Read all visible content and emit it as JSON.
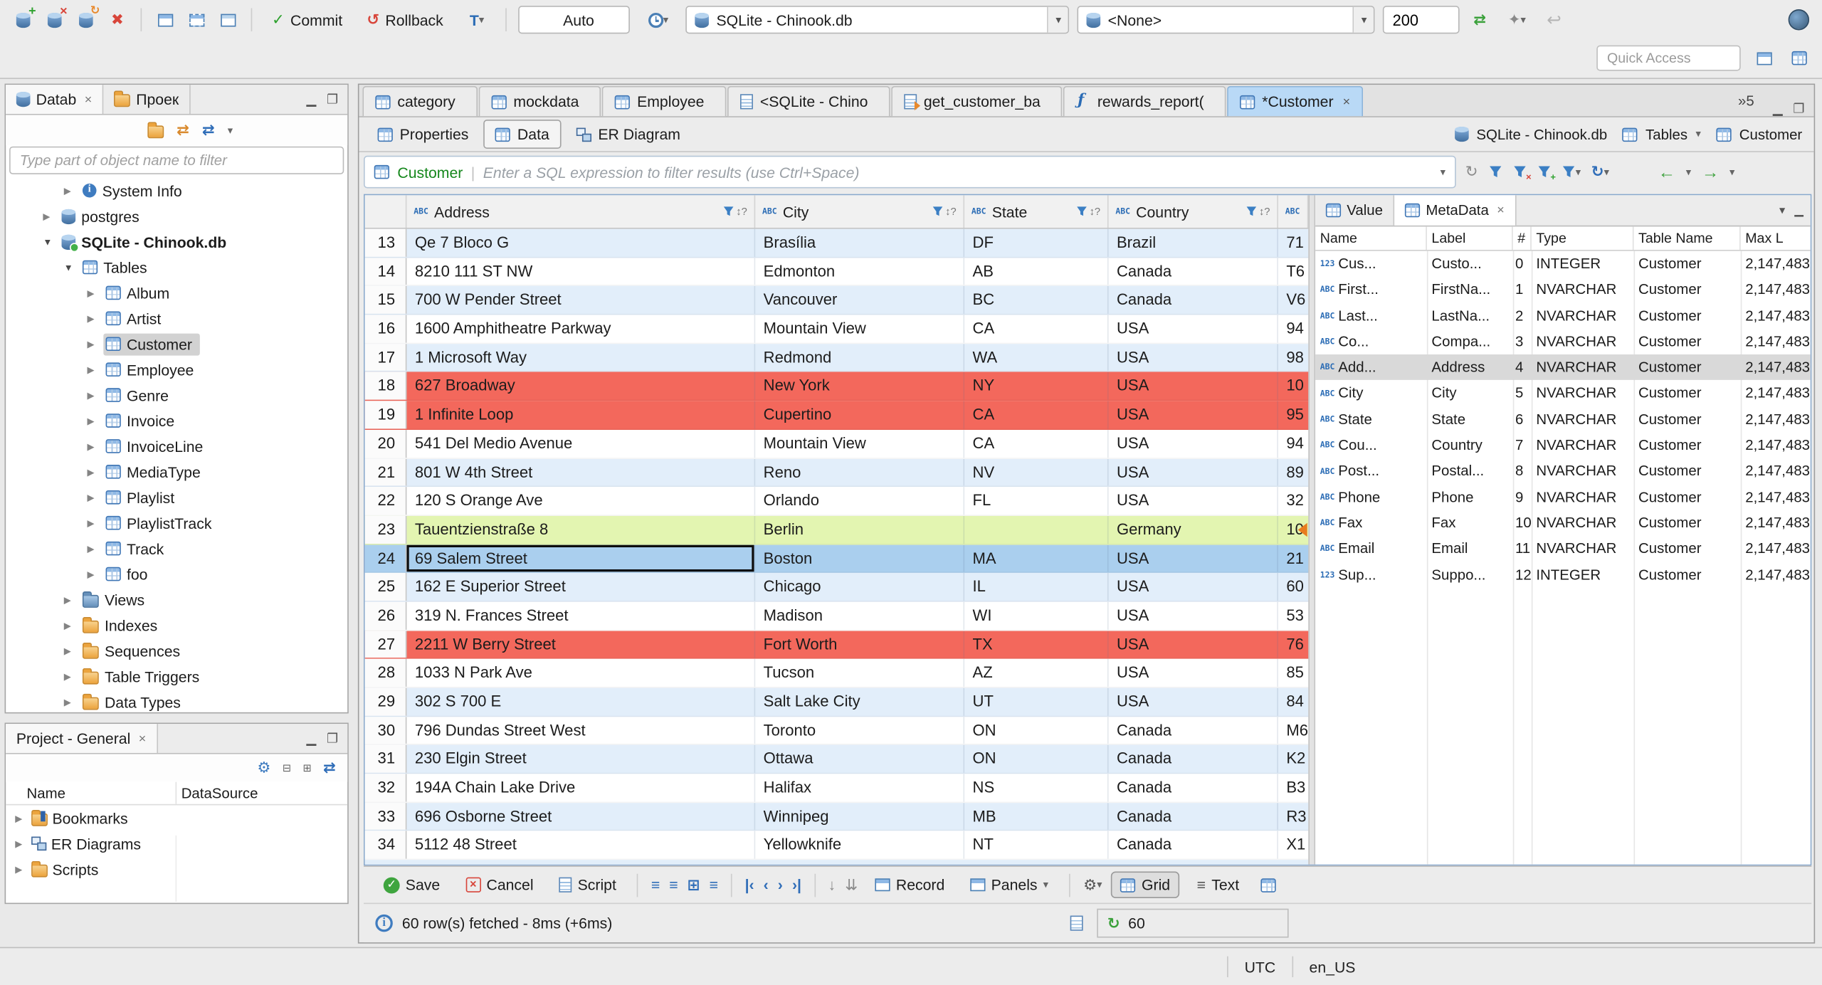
{
  "window": {
    "timezone": "UTC",
    "locale": "en_US"
  },
  "toolbar": {
    "commit_label": "Commit",
    "rollback_label": "Rollback",
    "txn_mode": "Auto",
    "connection": "SQLite - Chinook.db",
    "schema": "<None>",
    "fetch_limit": "200",
    "quick_access_placeholder": "Quick Access"
  },
  "navigator": {
    "tabs": [
      {
        "label": "Datab",
        "icon": "db",
        "state": "active",
        "close": "×"
      },
      {
        "label": "Проек",
        "icon": "folder",
        "state": ""
      }
    ],
    "filter_placeholder": "Type part of object name to filter",
    "tree": [
      {
        "label": "System Info",
        "depth": "1",
        "arrow": "right",
        "icon": "info",
        "state": ""
      },
      {
        "label": "postgres",
        "depth": "0",
        "arrow": "right",
        "icon": "db",
        "state": ""
      },
      {
        "label": "SQLite - Chinook.db",
        "depth": "0",
        "arrow": "down",
        "icon": "db-green",
        "state": "connected"
      },
      {
        "label": "Tables",
        "depth": "1",
        "arrow": "down",
        "icon": "folder-table",
        "state": ""
      },
      {
        "label": "Album",
        "depth": "2",
        "arrow": "right",
        "icon": "table",
        "state": ""
      },
      {
        "label": "Artist",
        "depth": "2",
        "arrow": "right",
        "icon": "table",
        "state": ""
      },
      {
        "label": "Customer",
        "depth": "2",
        "arrow": "right",
        "icon": "table",
        "state": "selected"
      },
      {
        "label": "Employee",
        "depth": "2",
        "arrow": "right",
        "icon": "table",
        "state": ""
      },
      {
        "label": "Genre",
        "depth": "2",
        "arrow": "right",
        "icon": "table",
        "state": ""
      },
      {
        "label": "Invoice",
        "depth": "2",
        "arrow": "right",
        "icon": "table",
        "state": ""
      },
      {
        "label": "InvoiceLine",
        "depth": "2",
        "arrow": "right",
        "icon": "table",
        "state": ""
      },
      {
        "label": "MediaType",
        "depth": "2",
        "arrow": "right",
        "icon": "table",
        "state": ""
      },
      {
        "label": "Playlist",
        "depth": "2",
        "arrow": "right",
        "icon": "table",
        "state": ""
      },
      {
        "label": "PlaylistTrack",
        "depth": "2",
        "arrow": "right",
        "icon": "table",
        "state": ""
      },
      {
        "label": "Track",
        "depth": "2",
        "arrow": "right",
        "icon": "table",
        "state": ""
      },
      {
        "label": "foo",
        "depth": "2",
        "arrow": "right",
        "icon": "table",
        "state": ""
      },
      {
        "label": "Views",
        "depth": "1",
        "arrow": "right",
        "icon": "folder-blue",
        "state": ""
      },
      {
        "label": "Indexes",
        "depth": "1",
        "arrow": "right",
        "icon": "folder",
        "state": ""
      },
      {
        "label": "Sequences",
        "depth": "1",
        "arrow": "right",
        "icon": "folder",
        "state": ""
      },
      {
        "label": "Table Triggers",
        "depth": "1",
        "arrow": "right",
        "icon": "folder",
        "state": ""
      },
      {
        "label": "Data Types",
        "depth": "1",
        "arrow": "right",
        "icon": "folder",
        "state": ""
      }
    ]
  },
  "project": {
    "tab": "Project - General",
    "close": "×",
    "columns": [
      "Name",
      "DataSource"
    ],
    "items": [
      {
        "label": "Bookmarks",
        "icon": "folder-bookmark",
        "arrow": "right"
      },
      {
        "label": "ER Diagrams",
        "icon": "diagram",
        "arrow": "right"
      },
      {
        "label": "Scripts",
        "icon": "folder",
        "arrow": "right"
      }
    ]
  },
  "editor": {
    "tabs": [
      {
        "label": "category",
        "icon": "table",
        "state": ""
      },
      {
        "label": "mockdata",
        "icon": "table",
        "state": ""
      },
      {
        "label": "Employee",
        "icon": "table",
        "state": ""
      },
      {
        "label": "<SQLite - Chino",
        "icon": "sql",
        "state": ""
      },
      {
        "label": "get_customer_ba",
        "icon": "view",
        "state": ""
      },
      {
        "label": "rewards_report(",
        "icon": "func",
        "state": ""
      },
      {
        "label": "*Customer",
        "icon": "table",
        "state": "active",
        "close": "×"
      }
    ],
    "more_tabs": "»5",
    "subtabs": [
      {
        "label": "Properties",
        "icon": "props",
        "state": ""
      },
      {
        "label": "Data",
        "icon": "grid",
        "state": "active"
      },
      {
        "label": "ER Diagram",
        "icon": "diagram",
        "state": ""
      }
    ],
    "breadcrumb": {
      "connection": "SQLite - Chinook.db",
      "container": "Tables",
      "entity": "Customer"
    },
    "filter_entity": "Customer",
    "filter_placeholder": "Enter a SQL expression to filter results (use Ctrl+Space)"
  },
  "grid": {
    "columns": [
      {
        "key": "address",
        "label": "Address",
        "chip": "ABC"
      },
      {
        "key": "city",
        "label": "City",
        "chip": "ABC"
      },
      {
        "key": "state",
        "label": "State",
        "chip": "ABC"
      },
      {
        "key": "country",
        "label": "Country",
        "chip": "ABC"
      },
      {
        "key": "extra",
        "label": "",
        "chip": "ABC"
      }
    ],
    "rows": [
      {
        "num": "13",
        "hl": "",
        "cells": [
          "Qe 7 Bloco G",
          "Brasília",
          "DF",
          "Brazil",
          "71"
        ]
      },
      {
        "num": "14",
        "hl": "",
        "cells": [
          "8210 111 ST NW",
          "Edmonton",
          "AB",
          "Canada",
          "T6"
        ]
      },
      {
        "num": "15",
        "hl": "",
        "cells": [
          "700 W Pender Street",
          "Vancouver",
          "BC",
          "Canada",
          "V6"
        ]
      },
      {
        "num": "16",
        "hl": "",
        "cells": [
          "1600 Amphitheatre Parkway",
          "Mountain View",
          "CA",
          "USA",
          "94"
        ]
      },
      {
        "num": "17",
        "hl": "",
        "cells": [
          "1 Microsoft Way",
          "Redmond",
          "WA",
          "USA",
          "98"
        ]
      },
      {
        "num": "18",
        "hl": "red",
        "cells": [
          "627 Broadway",
          "New York",
          "NY",
          "USA",
          "10"
        ]
      },
      {
        "num": "19",
        "hl": "red",
        "cells": [
          "1 Infinite Loop",
          "Cupertino",
          "CA",
          "USA",
          "95"
        ]
      },
      {
        "num": "20",
        "hl": "",
        "cells": [
          "541 Del Medio Avenue",
          "Mountain View",
          "CA",
          "USA",
          "94"
        ]
      },
      {
        "num": "21",
        "hl": "",
        "cells": [
          "801 W 4th Street",
          "Reno",
          "NV",
          "USA",
          "89"
        ]
      },
      {
        "num": "22",
        "hl": "",
        "cells": [
          "120 S Orange Ave",
          "Orlando",
          "FL",
          "USA",
          "32"
        ]
      },
      {
        "num": "23",
        "hl": "green",
        "cells": [
          "Tauentzienstraße 8",
          "Berlin",
          "",
          "Germany",
          "10"
        ]
      },
      {
        "num": "24",
        "hl": "sel",
        "cells": [
          "69 Salem Street",
          "Boston",
          "MA",
          "USA",
          "21"
        ]
      },
      {
        "num": "25",
        "hl": "",
        "cells": [
          "162 E Superior Street",
          "Chicago",
          "IL",
          "USA",
          "60"
        ]
      },
      {
        "num": "26",
        "hl": "",
        "cells": [
          "319 N. Frances Street",
          "Madison",
          "WI",
          "USA",
          "53"
        ]
      },
      {
        "num": "27",
        "hl": "red",
        "cells": [
          "2211 W Berry Street",
          "Fort Worth",
          "TX",
          "USA",
          "76"
        ]
      },
      {
        "num": "28",
        "hl": "",
        "cells": [
          "1033 N Park Ave",
          "Tucson",
          "AZ",
          "USA",
          "85"
        ]
      },
      {
        "num": "29",
        "hl": "",
        "cells": [
          "302 S 700 E",
          "Salt Lake City",
          "UT",
          "USA",
          "84"
        ]
      },
      {
        "num": "30",
        "hl": "",
        "cells": [
          "796 Dundas Street West",
          "Toronto",
          "ON",
          "Canada",
          "M6"
        ]
      },
      {
        "num": "31",
        "hl": "",
        "cells": [
          "230 Elgin Street",
          "Ottawa",
          "ON",
          "Canada",
          "K2"
        ]
      },
      {
        "num": "32",
        "hl": "",
        "cells": [
          "194A Chain Lake Drive",
          "Halifax",
          "NS",
          "Canada",
          "B3"
        ]
      },
      {
        "num": "33",
        "hl": "",
        "cells": [
          "696 Osborne Street",
          "Winnipeg",
          "MB",
          "Canada",
          "R3"
        ]
      },
      {
        "num": "34",
        "hl": "",
        "cells": [
          "5112 48 Street",
          "Yellowknife",
          "NT",
          "Canada",
          "X1"
        ]
      }
    ]
  },
  "metadata": {
    "tabs": [
      {
        "label": "Value",
        "icon": "value",
        "state": ""
      },
      {
        "label": "MetaData",
        "icon": "grid",
        "state": "active",
        "close": "×"
      }
    ],
    "columns": [
      "Name",
      "Label",
      "#",
      "Type",
      "Table Name",
      "Max L"
    ],
    "rows": [
      {
        "icon": "123",
        "name": "Cus...",
        "label": "Custo...",
        "num": "0",
        "type": "INTEGER",
        "table": "Customer",
        "max": "2,147,483",
        "state": ""
      },
      {
        "icon": "ABC",
        "name": "First...",
        "label": "FirstNa...",
        "num": "1",
        "type": "NVARCHAR",
        "table": "Customer",
        "max": "2,147,483",
        "state": ""
      },
      {
        "icon": "ABC",
        "name": "Last...",
        "label": "LastNa...",
        "num": "2",
        "type": "NVARCHAR",
        "table": "Customer",
        "max": "2,147,483",
        "state": ""
      },
      {
        "icon": "ABC",
        "name": "Co...",
        "label": "Compa...",
        "num": "3",
        "type": "NVARCHAR",
        "table": "Customer",
        "max": "2,147,483",
        "state": ""
      },
      {
        "icon": "ABC",
        "name": "Add...",
        "label": "Address",
        "num": "4",
        "type": "NVARCHAR",
        "table": "Customer",
        "max": "2,147,483",
        "state": "selected"
      },
      {
        "icon": "ABC",
        "name": "City",
        "label": "City",
        "num": "5",
        "type": "NVARCHAR",
        "table": "Customer",
        "max": "2,147,483",
        "state": ""
      },
      {
        "icon": "ABC",
        "name": "State",
        "label": "State",
        "num": "6",
        "type": "NVARCHAR",
        "table": "Customer",
        "max": "2,147,483",
        "state": ""
      },
      {
        "icon": "ABC",
        "name": "Cou...",
        "label": "Country",
        "num": "7",
        "type": "NVARCHAR",
        "table": "Customer",
        "max": "2,147,483",
        "state": ""
      },
      {
        "icon": "ABC",
        "name": "Post...",
        "label": "Postal...",
        "num": "8",
        "type": "NVARCHAR",
        "table": "Customer",
        "max": "2,147,483",
        "state": ""
      },
      {
        "icon": "ABC",
        "name": "Phone",
        "label": "Phone",
        "num": "9",
        "type": "NVARCHAR",
        "table": "Customer",
        "max": "2,147,483",
        "state": ""
      },
      {
        "icon": "ABC",
        "name": "Fax",
        "label": "Fax",
        "num": "10",
        "type": "NVARCHAR",
        "table": "Customer",
        "max": "2,147,483",
        "state": ""
      },
      {
        "icon": "ABC",
        "name": "Email",
        "label": "Email",
        "num": "11",
        "type": "NVARCHAR",
        "table": "Customer",
        "max": "2,147,483",
        "state": ""
      },
      {
        "icon": "123",
        "name": "Sup...",
        "label": "Suppo...",
        "num": "12",
        "type": "INTEGER",
        "table": "Customer",
        "max": "2,147,483",
        "state": ""
      }
    ]
  },
  "result_toolbar": {
    "save": "Save",
    "cancel": "Cancel",
    "script": "Script",
    "record": "Record",
    "panels": "Panels",
    "grid": "Grid",
    "text": "Text"
  },
  "status": {
    "fetched": "60 row(s) fetched - 8ms (+6ms)",
    "refresh_count": "60"
  }
}
